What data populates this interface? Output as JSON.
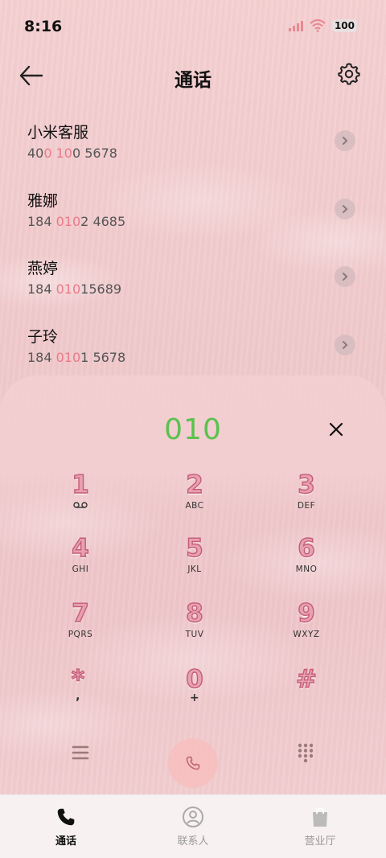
{
  "status_bar": {
    "time": "8:16",
    "battery": "100"
  },
  "header": {
    "title": "通话"
  },
  "contacts": [
    {
      "name": "小米客服",
      "number_parts": [
        "40",
        "0 10",
        "0 5678"
      ]
    },
    {
      "name": "雅娜",
      "number_parts": [
        "184 ",
        "010",
        "2 4685"
      ]
    },
    {
      "name": "燕婷",
      "number_parts": [
        "184 ",
        "010",
        "15689"
      ]
    },
    {
      "name": "子玲",
      "number_parts": [
        "184 ",
        "010",
        "1 5678"
      ]
    }
  ],
  "dialer": {
    "input": "010",
    "keys": [
      {
        "digit": "1",
        "letters": "ꝏ"
      },
      {
        "digit": "2",
        "letters": "ABC"
      },
      {
        "digit": "3",
        "letters": "DEF"
      },
      {
        "digit": "4",
        "letters": "GHI"
      },
      {
        "digit": "5",
        "letters": "JKL"
      },
      {
        "digit": "6",
        "letters": "MNO"
      },
      {
        "digit": "7",
        "letters": "PQRS"
      },
      {
        "digit": "8",
        "letters": "TUV"
      },
      {
        "digit": "9",
        "letters": "WXYZ"
      },
      {
        "digit": "*",
        "letters": ","
      },
      {
        "digit": "0",
        "letters": "+"
      },
      {
        "digit": "#",
        "letters": ""
      }
    ]
  },
  "bottom_nav": {
    "items": [
      {
        "label": "通话",
        "active": true
      },
      {
        "label": "联系人",
        "active": false
      },
      {
        "label": "营业厅",
        "active": false
      }
    ]
  },
  "colors": {
    "accent_green": "#5bc24e",
    "highlight_pink": "#ea7a8a",
    "key_outline": "#c45d78"
  }
}
